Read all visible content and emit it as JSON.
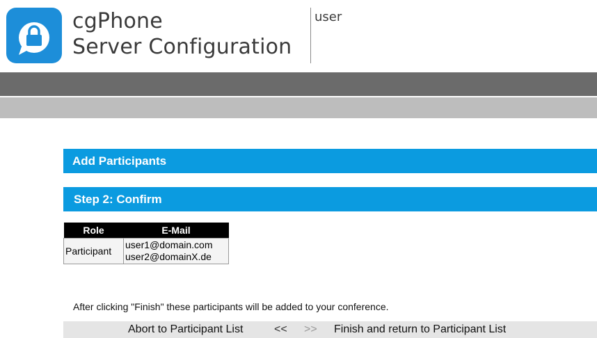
{
  "header": {
    "app_name_line1": "cgPhone",
    "app_name_line2": "Server Configuration",
    "user": "user",
    "logo_icon": "lock-chat-bubble-icon",
    "logo_color": "#1d8ed9"
  },
  "sections": {
    "title": "Add Participants",
    "step": "Step 2: Confirm"
  },
  "table": {
    "columns": [
      "Role",
      "E-Mail"
    ],
    "rows": [
      {
        "role": "Participant",
        "emails": [
          "user1@domain.com",
          "user2@domainX.de"
        ]
      }
    ]
  },
  "note": "After clicking \"Finish\" these participants will be added to your conference.",
  "actions": {
    "abort": "Abort to Participant List",
    "prev": "<<",
    "next": ">>",
    "finish": "Finish and return to Participant List"
  },
  "colors": {
    "accent": "#0b9be0",
    "band_dark": "#6b6b6b",
    "band_light": "#bdbdbd"
  }
}
